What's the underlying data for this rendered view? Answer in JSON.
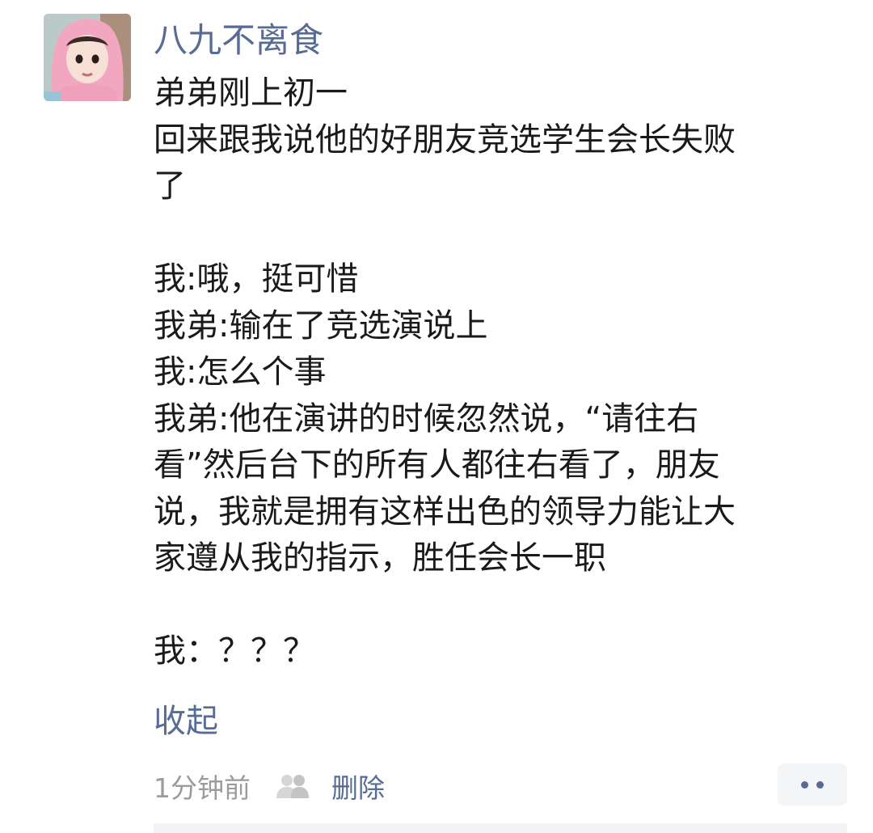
{
  "post": {
    "username": "八九不离食",
    "avatar_icon": "avatar-girl-pink-hood",
    "lines": [
      "弟弟刚上初一",
      "回来跟我说他的好朋友竞选学生会长失败",
      "了",
      "",
      "我:哦，挺可惜",
      "我弟:输在了竞选演说上",
      "我:怎么个事",
      "我弟:他在演讲的时候忽然说，“请往右",
      "看”然后台下的所有人都往右看了，朋友",
      "说，我就是拥有这样出色的领导力能让大",
      "家遵从我的指示，胜任会长一职",
      "",
      "我：？？？"
    ],
    "collapse_label": "收起",
    "time": "1分钟前",
    "visibility_icon": "friends-icon",
    "delete_label": "删除",
    "more_icon": "more-dots-icon"
  },
  "colors": {
    "link": "#576b95",
    "text": "#1a1a1a",
    "muted": "#9b9b9b",
    "button_bg": "#f4f5f7"
  }
}
